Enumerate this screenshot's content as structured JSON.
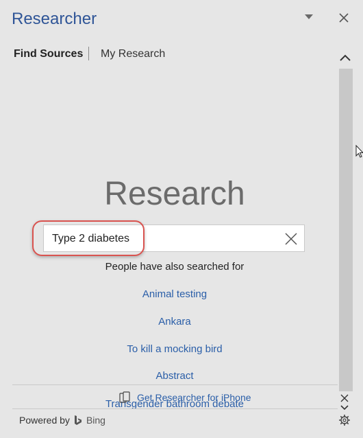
{
  "pane": {
    "title": "Researcher"
  },
  "tabs": [
    {
      "label": "Find Sources",
      "active": true
    },
    {
      "label": "My Research",
      "active": false
    }
  ],
  "main": {
    "heading": "Research",
    "search": {
      "value": "Type 2 diabetes"
    },
    "also_label": "People have also searched for",
    "suggestions": [
      "Animal testing",
      "Ankara",
      "To kill a mocking bird",
      "Abstract",
      "Transgender bathroom debate"
    ]
  },
  "footer": {
    "get_app": "Get Researcher for iPhone",
    "powered_by": "Powered by",
    "bing": "Bing"
  },
  "colors": {
    "accent": "#2f5597",
    "link": "#2a5ea8",
    "highlight": "#d9534f",
    "background": "#e6e6e6"
  }
}
